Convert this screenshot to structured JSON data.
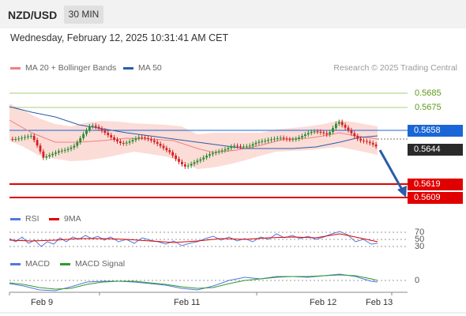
{
  "header": {
    "pair": "NZD/USD",
    "timeframe": "30 MIN"
  },
  "datetime": "Wednesday, February 12, 2025 10:31:41 AM CET",
  "legend": {
    "ma20": {
      "label": "MA 20 + Bollinger Bands",
      "color": "#f08080"
    },
    "ma50": {
      "label": "MA 50",
      "color": "#2a5caa"
    }
  },
  "credit": "Research © 2025 Trading Central",
  "levels": {
    "resistance2": {
      "value": "0.5685",
      "color": "#5a9a1a"
    },
    "resistance1": {
      "value": "0.5675",
      "color": "#5a9a1a"
    },
    "pivot": {
      "value": "0.5658",
      "color": "#1a66d6"
    },
    "last": {
      "value": "0.5644",
      "color": "#2a2a2a"
    },
    "support1": {
      "value": "0.5619",
      "color": "#e00000"
    },
    "support2": {
      "value": "0.5609",
      "color": "#e00000"
    }
  },
  "rsi_legend": {
    "rsi": "RSI",
    "ma9": "9MA"
  },
  "rsi_levels": [
    "70",
    "50",
    "30"
  ],
  "macd_legend": {
    "macd": "MACD",
    "signal": "MACD Signal"
  },
  "macd_zero": "0",
  "xaxis": [
    "Feb 9",
    "Feb 11",
    "Feb 12",
    "Feb 13"
  ],
  "colors": {
    "up": "#2e8b2e",
    "down": "#d42020",
    "band": "#fbd6d0"
  }
}
